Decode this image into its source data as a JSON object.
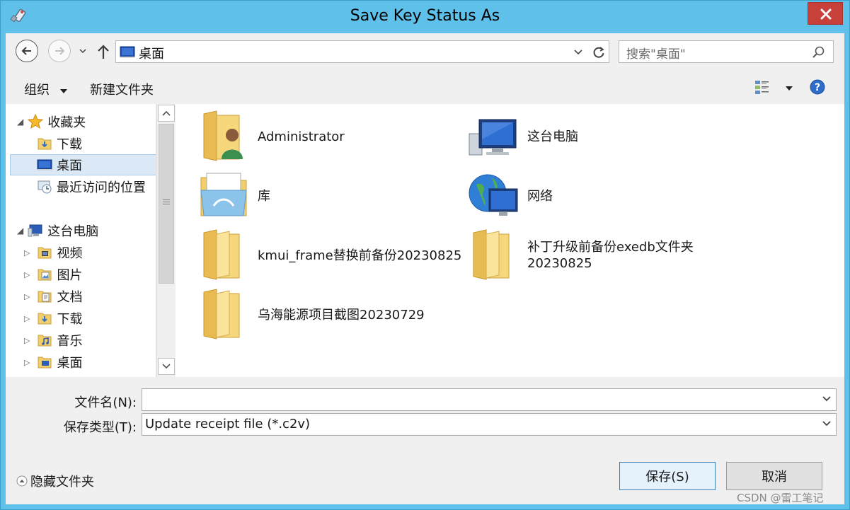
{
  "window": {
    "title": "Save Key Status As",
    "icon": "usb-key-icon",
    "close": "close-icon"
  },
  "nav": {
    "back_icon": "back-arrow-icon",
    "forward_icon": "forward-arrow-icon",
    "recent_icon": "chevron-down-icon",
    "up_icon": "up-arrow-icon",
    "address": "桌面",
    "refresh_icon": "refresh-icon",
    "search_placeholder": "搜索\"桌面\"",
    "search_icon": "search-icon"
  },
  "toolbar": {
    "organize": "组织",
    "new_folder": "新建文件夹",
    "view_icon": "view-options-icon",
    "help_icon": "help-icon"
  },
  "sidebar": {
    "favorites": {
      "label": "收藏夹",
      "items": [
        {
          "label": "下载",
          "icon": "downloads-folder-icon"
        },
        {
          "label": "桌面",
          "icon": "desktop-icon",
          "selected": true
        },
        {
          "label": "最近访问的位置",
          "icon": "recent-places-icon"
        }
      ]
    },
    "this_pc": {
      "label": "这台电脑",
      "items": [
        {
          "label": "视频",
          "icon": "videos-folder-icon"
        },
        {
          "label": "图片",
          "icon": "pictures-folder-icon"
        },
        {
          "label": "文档",
          "icon": "documents-folder-icon"
        },
        {
          "label": "下载",
          "icon": "downloads-folder-icon"
        },
        {
          "label": "音乐",
          "icon": "music-folder-icon"
        },
        {
          "label": "桌面",
          "icon": "desktop-icon"
        }
      ]
    }
  },
  "items": [
    {
      "label": "Administrator",
      "icon": "user-folder-icon"
    },
    {
      "label": "这台电脑",
      "icon": "computer-icon"
    },
    {
      "label": "库",
      "icon": "libraries-icon"
    },
    {
      "label": "网络",
      "icon": "network-icon"
    },
    {
      "label": "kmui_frame替换前备份20230825",
      "icon": "folder-icon"
    },
    {
      "label": "补丁升级前备份exedb文件夹",
      "label2": "20230825",
      "icon": "folder-icon"
    },
    {
      "label": "乌海能源项目截图20230729",
      "icon": "folder-icon"
    }
  ],
  "form": {
    "filename_label": "文件名(N):",
    "filename_value": "",
    "filetype_label": "保存类型(T):",
    "filetype_value": "Update receipt file (*.c2v)"
  },
  "buttons": {
    "hide_folders": "隐藏文件夹",
    "save": "保存(S)",
    "cancel": "取消"
  },
  "watermark": "CSDN @雷工笔记",
  "colors": {
    "titlebar": "#5fc0ea",
    "close": "#c7403a",
    "selection": "#dbe9f7",
    "folder": "#f2cf6e"
  }
}
